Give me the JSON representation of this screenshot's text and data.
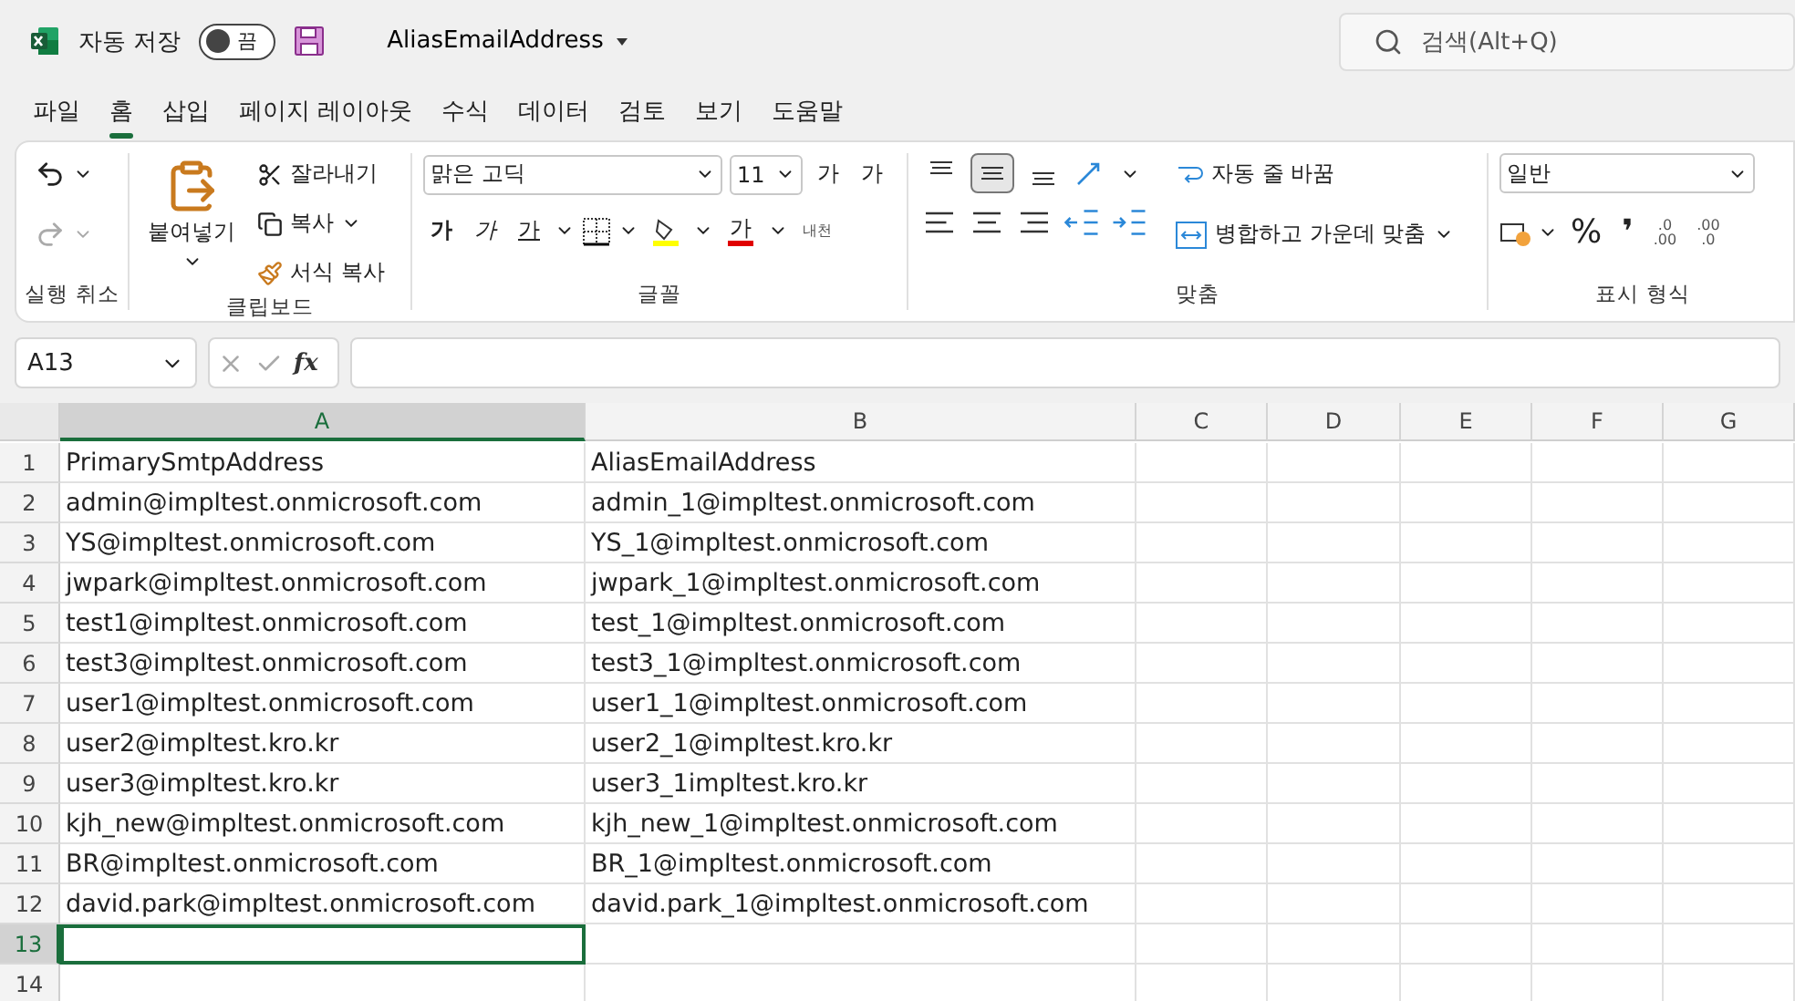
{
  "title_bar": {
    "autosave_label": "자동 저장",
    "autosave_toggle": {
      "label": "끔",
      "on": false
    },
    "file_name": "AliasEmailAddress",
    "search_placeholder": "검색(Alt+Q)"
  },
  "menu_tabs": [
    {
      "label": "파일",
      "selected": false
    },
    {
      "label": "홈",
      "selected": true
    },
    {
      "label": "삽입",
      "selected": false
    },
    {
      "label": "페이지 레이아웃",
      "selected": false
    },
    {
      "label": "수식",
      "selected": false
    },
    {
      "label": "데이터",
      "selected": false
    },
    {
      "label": "검토",
      "selected": false
    },
    {
      "label": "보기",
      "selected": false
    },
    {
      "label": "도움말",
      "selected": false
    }
  ],
  "ribbon": {
    "undo_group": {
      "label": "실행 취소"
    },
    "clipboard_group": {
      "label": "클립보드",
      "paste": "붙여넣기",
      "cut": "잘라내기",
      "copy": "복사",
      "format_painter": "서식 복사"
    },
    "font_group": {
      "label": "글꼴",
      "font_name": "맑은 고딕",
      "font_size": "11",
      "grow": "가",
      "shrink": "가",
      "bold": "가",
      "italic": "가",
      "underline": "가",
      "font_color": "가",
      "phonetic": "내천"
    },
    "alignment_group": {
      "label": "맞춤",
      "vertical_align": [
        {
          "kind": "top",
          "selected": false
        },
        {
          "kind": "middle",
          "selected": true
        },
        {
          "kind": "bottom",
          "selected": false
        }
      ],
      "wrap_text": "자동 줄 바꿈",
      "merge_center": "병합하고 가운데 맞춤"
    },
    "number_group": {
      "label": "표시 형식",
      "format": "일반",
      "percent": "%",
      "comma": "❜",
      "increase_decimal": [
        ".0",
        ".00"
      ],
      "decrease_decimal": [
        ".00",
        ".0"
      ]
    }
  },
  "formula_bar": {
    "name_box": "A13",
    "fx_label": "fx"
  },
  "sheet": {
    "columns": [
      {
        "label": "A",
        "selected": true
      },
      {
        "label": "B",
        "selected": false
      },
      {
        "label": "C",
        "selected": false
      },
      {
        "label": "D",
        "selected": false
      },
      {
        "label": "E",
        "selected": false
      },
      {
        "label": "F",
        "selected": false
      },
      {
        "label": "G",
        "selected": false
      }
    ],
    "rows": [
      {
        "number": "1",
        "selected": false,
        "cells": [
          "PrimarySmtpAddress",
          "AliasEmailAddress"
        ]
      },
      {
        "number": "2",
        "selected": false,
        "cells": [
          "admin@impltest.onmicrosoft.com",
          "admin_1@impltest.onmicrosoft.com"
        ]
      },
      {
        "number": "3",
        "selected": false,
        "cells": [
          "YS@impltest.onmicrosoft.com",
          "YS_1@impltest.onmicrosoft.com"
        ]
      },
      {
        "number": "4",
        "selected": false,
        "cells": [
          "jwpark@impltest.onmicrosoft.com",
          "jwpark_1@impltest.onmicrosoft.com"
        ]
      },
      {
        "number": "5",
        "selected": false,
        "cells": [
          "test1@impltest.onmicrosoft.com",
          "test_1@impltest.onmicrosoft.com"
        ]
      },
      {
        "number": "6",
        "selected": false,
        "cells": [
          "test3@impltest.onmicrosoft.com",
          "test3_1@impltest.onmicrosoft.com"
        ]
      },
      {
        "number": "7",
        "selected": false,
        "cells": [
          "user1@impltest.onmicrosoft.com",
          "user1_1@impltest.onmicrosoft.com"
        ]
      },
      {
        "number": "8",
        "selected": false,
        "cells": [
          "user2@impltest.kro.kr",
          "user2_1@impltest.kro.kr"
        ]
      },
      {
        "number": "9",
        "selected": false,
        "cells": [
          "user3@impltest.kro.kr",
          "user3_1impltest.kro.kr"
        ]
      },
      {
        "number": "10",
        "selected": false,
        "cells": [
          "kjh_new@impltest.onmicrosoft.com",
          "kjh_new_1@impltest.onmicrosoft.com"
        ]
      },
      {
        "number": "11",
        "selected": false,
        "cells": [
          "BR@impltest.onmicrosoft.com",
          "BR_1@impltest.onmicrosoft.com"
        ]
      },
      {
        "number": "12",
        "selected": false,
        "cells": [
          "david.park@impltest.onmicrosoft.com",
          "david.park_1@impltest.onmicrosoft.com"
        ]
      },
      {
        "number": "13",
        "selected": true,
        "cells": []
      },
      {
        "number": "14",
        "selected": false,
        "cells": []
      }
    ]
  }
}
